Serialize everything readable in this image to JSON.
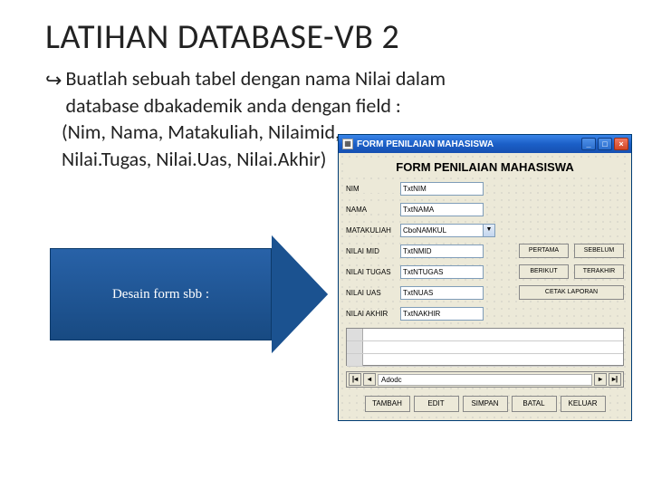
{
  "title": "LATIHAN DATABASE-VB 2",
  "bullet": {
    "line1": "Buatlah sebuah tabel dengan nama Nilai dalam",
    "line2": "database dbakademik anda dengan field :",
    "line3": "(Nim, Nama, Matakuliah, Nilaimid,",
    "line4": "Nilai.Tugas, Nilai.Uas, Nilai.Akhir)"
  },
  "arrow_label": "Desain form sbb :",
  "vbform": {
    "window_title": "FORM PENILAIAN MAHASISWA",
    "form_heading": "FORM PENILAIAN MAHASISWA",
    "labels": {
      "nim": "NIM",
      "nama": "NAMA",
      "matakuliah": "MATAKULIAH",
      "nilaimid": "NILAI MID",
      "nilaitugas": "NILAI TUGAS",
      "nilaiuas": "NILAI UAS",
      "nilaiakhir": "NILAI AKHIR"
    },
    "fields": {
      "nim": "TxtNIM",
      "nama": "TxtNAMA",
      "matakuliah": "CboNAMKUL",
      "nilaimid": "TxtNMID",
      "nilaitugas": "TxtNTUGAS",
      "nilaiuas": "TxtNUAS",
      "nilaiakhir": "TxtNAKHIR"
    },
    "side_buttons": {
      "pertama": "PERTAMA",
      "sebelum": "SEBELUM",
      "berikut": "BERIKUT",
      "terakhir": "TERAKHIR",
      "cetak": "CETAK LAPORAN"
    },
    "nav_text": "Adodc",
    "bottom_buttons": [
      "TAMBAH",
      "EDIT",
      "SIMPAN",
      "BATAL",
      "KELUAR"
    ]
  }
}
